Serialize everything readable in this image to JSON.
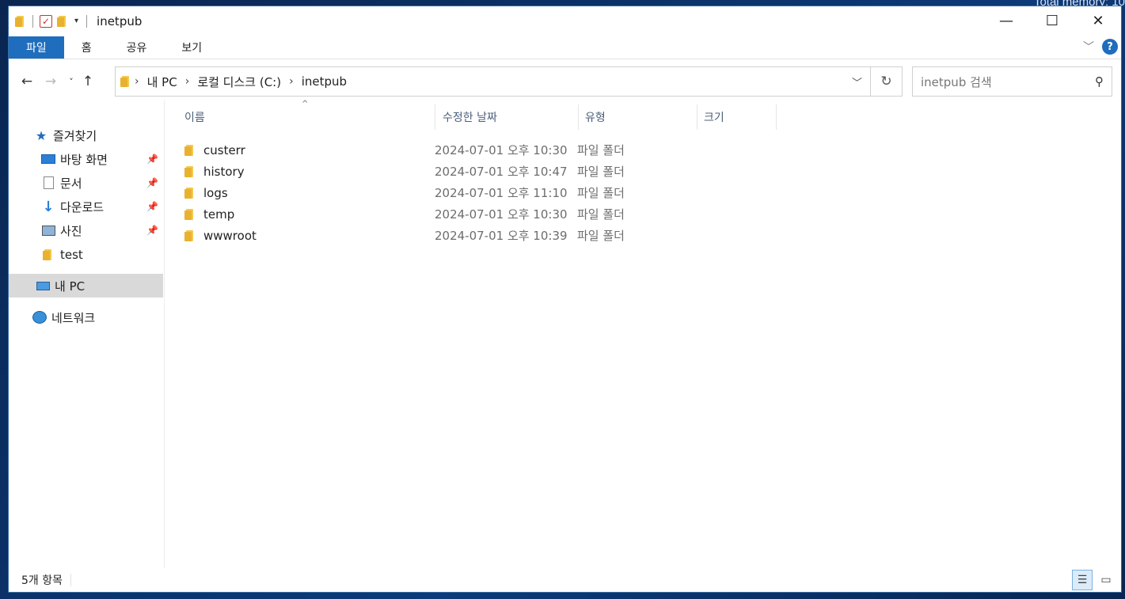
{
  "desktop": {
    "overlay_text": "Total memory: 10"
  },
  "window": {
    "title": "inetpub",
    "controls": {
      "minimize": "—",
      "maximize": "☐",
      "close": "✕"
    }
  },
  "ribbon": {
    "tabs": [
      {
        "label": "파일",
        "active": true
      },
      {
        "label": "홈"
      },
      {
        "label": "공유"
      },
      {
        "label": "보기"
      }
    ]
  },
  "nav": {
    "back": "←",
    "forward": "→",
    "recent": "˅",
    "up": "↑",
    "breadcrumb": [
      "내 PC",
      "로컬 디스크 (C:)",
      "inetpub"
    ],
    "refresh": "↻",
    "search_placeholder": "inetpub 검색"
  },
  "sidebar": {
    "quick_access": "즐겨찾기",
    "pinned": [
      {
        "label": "바탕 화면",
        "icon": "desktop-icon"
      },
      {
        "label": "문서",
        "icon": "document-icon"
      },
      {
        "label": "다운로드",
        "icon": "download-icon"
      },
      {
        "label": "사진",
        "icon": "pictures-icon"
      }
    ],
    "folder": "test",
    "this_pc": "내 PC",
    "network": "네트워크"
  },
  "columns": {
    "name": "이름",
    "date": "수정한 날짜",
    "type": "유형",
    "size": "크기"
  },
  "files": [
    {
      "name": "custerr",
      "date": "2024-07-01 오후 10:30",
      "type": "파일 폴더"
    },
    {
      "name": "history",
      "date": "2024-07-01 오후 10:47",
      "type": "파일 폴더"
    },
    {
      "name": "logs",
      "date": "2024-07-01 오후 11:10",
      "type": "파일 폴더"
    },
    {
      "name": "temp",
      "date": "2024-07-01 오후 10:30",
      "type": "파일 폴더"
    },
    {
      "name": "wwwroot",
      "date": "2024-07-01 오후 10:39",
      "type": "파일 폴더"
    }
  ],
  "status": {
    "item_count": "5개 항목"
  }
}
